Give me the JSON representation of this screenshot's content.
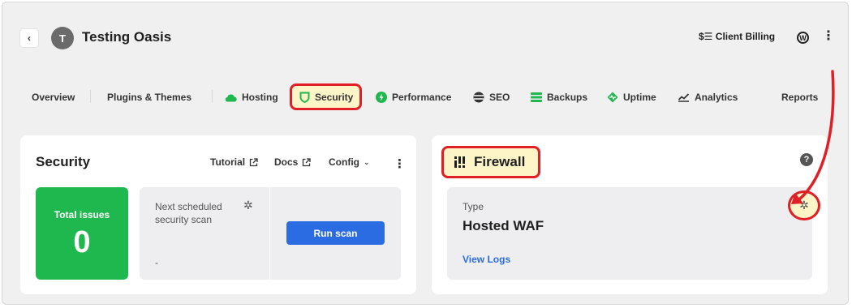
{
  "header": {
    "back_icon": "‹",
    "avatar_letter": "T",
    "site_title": "Testing Oasis",
    "client_billing_label": "Client Billing",
    "client_billing_icon": "$☰",
    "wordpress_icon": "W",
    "menu_icon": "⋮"
  },
  "nav": {
    "tabs": [
      {
        "label": "Overview"
      },
      {
        "label": "Plugins & Themes"
      },
      {
        "label": "Hosting",
        "icon": "cloud-icon"
      },
      {
        "label": "Security",
        "icon": "shield-icon"
      },
      {
        "label": "Performance",
        "icon": "bolt-icon"
      },
      {
        "label": "SEO",
        "icon": "globe-icon"
      },
      {
        "label": "Backups",
        "icon": "stack-icon"
      },
      {
        "label": "Uptime",
        "icon": "heartbeat-icon"
      },
      {
        "label": "Analytics",
        "icon": "chart-icon"
      },
      {
        "label": "Reports"
      }
    ]
  },
  "security_card": {
    "title": "Security",
    "links": {
      "tutorial": "Tutorial",
      "docs": "Docs",
      "config": "Config"
    },
    "total_issues_label": "Total issues",
    "total_issues_value": "0",
    "next_scan_label": "Next scheduled security scan",
    "next_scan_value": "-",
    "run_scan_label": "Run scan"
  },
  "firewall_card": {
    "title": "Firewall",
    "help": "?",
    "type_label": "Type",
    "type_value": "Hosted WAF",
    "view_logs": "View Logs"
  },
  "colors": {
    "accent_blue": "#2b6ce3",
    "success_green": "#1fb84e",
    "highlight_red": "#e01f26",
    "highlight_fill": "#fdf4c8"
  }
}
